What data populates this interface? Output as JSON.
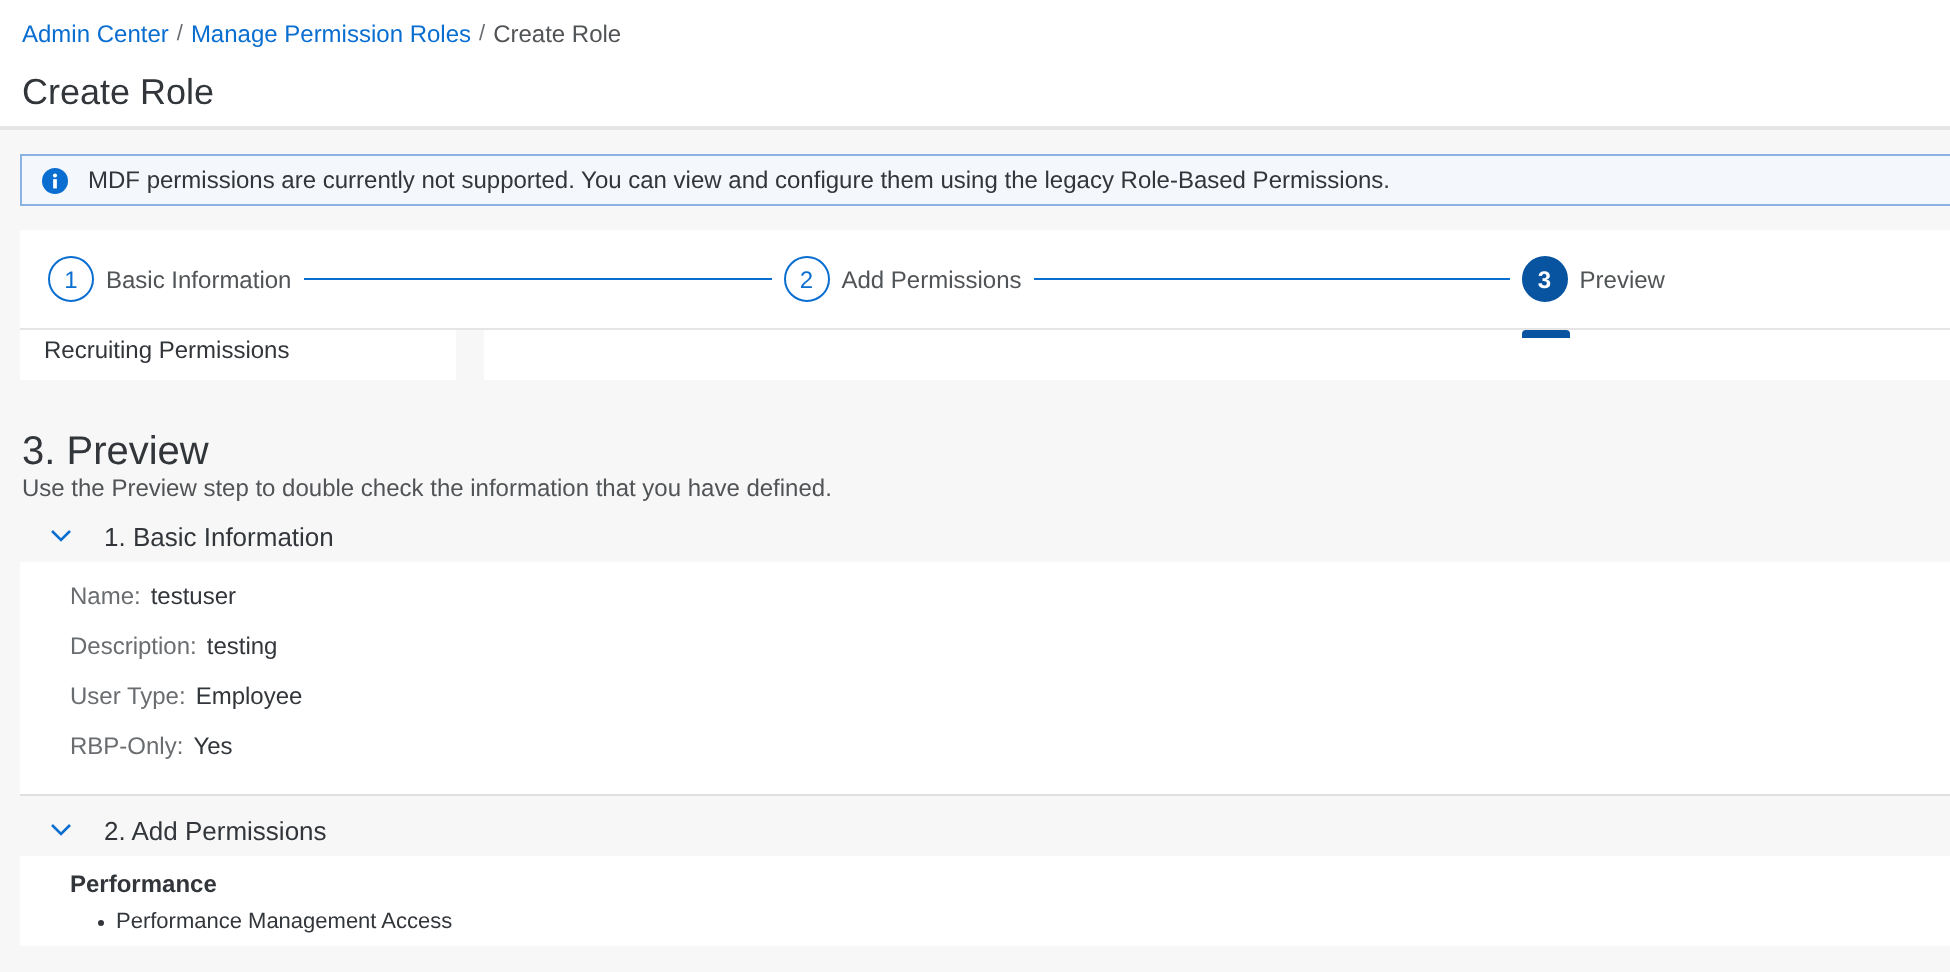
{
  "breadcrumb": [
    {
      "label": "Admin Center",
      "kind": "link"
    },
    {
      "label": "/",
      "kind": "separator"
    },
    {
      "label": "Manage Permission Roles",
      "kind": "link"
    },
    {
      "label": "/",
      "kind": "separator"
    },
    {
      "label": "Create Role",
      "kind": "current"
    }
  ],
  "page_title": "Create Role",
  "info_message": "MDF permissions are currently not supported. You can view and configure them using the legacy Role-Based Permissions.",
  "wizard_steps": [
    {
      "number": "1",
      "label": "Basic Information",
      "selected": false
    },
    {
      "number": "2",
      "label": "Add Permissions",
      "selected": false
    },
    {
      "number": "3",
      "label": "Preview",
      "selected": true
    }
  ],
  "side_list": {
    "item": "Recruiting Permissions"
  },
  "preview": {
    "title": "3. Preview",
    "description": "Use the Preview step to double check the information that you have defined.",
    "sections": [
      {
        "title": "1. Basic Information",
        "expanded": true,
        "kind": "fields",
        "fields": [
          {
            "label": "Name:",
            "value": "testuser"
          },
          {
            "label": "Description:",
            "value": "testing"
          },
          {
            "label": "User Type:",
            "value": "Employee"
          },
          {
            "label": "RBP-Only:",
            "value": "Yes"
          }
        ]
      },
      {
        "title": "2. Add Permissions",
        "expanded": true,
        "kind": "permissions",
        "group": "Performance",
        "items": [
          "Performance Management Access"
        ]
      }
    ]
  }
}
